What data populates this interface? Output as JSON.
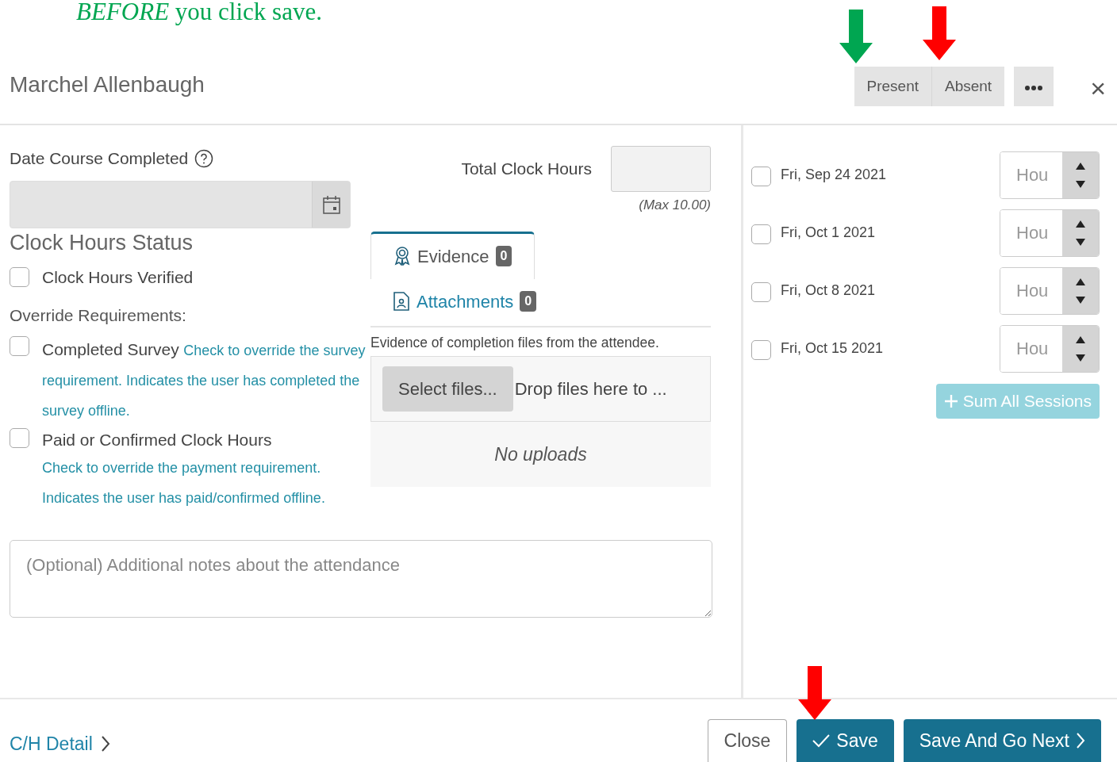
{
  "annotation": {
    "text": "*BEFORE* you click save."
  },
  "annotation_arrows": [
    {
      "color": "#00a651"
    },
    {
      "color": "#ff0000"
    },
    {
      "color": "#ff0000"
    }
  ],
  "header": {
    "title": "Marchel Allenbaugh",
    "attendance_buttons": [
      {
        "label": "Present",
        "selected": false
      },
      {
        "label": "Absent",
        "selected": false
      }
    ],
    "close": "×"
  },
  "date_course_completed": {
    "label": "Date Course Completed"
  },
  "total_clock_hours": {
    "label": "Total Clock Hours",
    "hint": "(Max 10.00)"
  },
  "clock_hours_status": {
    "heading": "Clock Hours Status",
    "verified": {
      "label": "Clock Hours Verified",
      "checked": false
    }
  },
  "override_requirements": {
    "heading": "Override Requirements:",
    "items": [
      {
        "label": "Completed Survey",
        "description": "Check to override the survey requirement. Indicates the user has completed the survey offline.",
        "checked": false
      },
      {
        "label": "Paid or Confirmed Clock Hours",
        "description": "Check to override the payment requirement. Indicates the user has paid/confirmed offline.",
        "checked": false
      }
    ]
  },
  "tabs": [
    {
      "label": "Evidence",
      "count": "0",
      "selected": true,
      "kind": "award"
    },
    {
      "label": "Attachments",
      "count": "0",
      "selected": false,
      "kind": "document"
    }
  ],
  "tab_description": "Evidence of completion files from the attendee.",
  "upload": {
    "select_button": "Select files...",
    "drop_text": "Drop files here to ...",
    "empty": "No uploads"
  },
  "notes": {
    "placeholder": "(Optional) Additional notes about the attendance"
  },
  "sessions": [
    {
      "date": "Fri, Sep 24 2021",
      "checked": false,
      "placeholder": "Hou"
    },
    {
      "date": "Fri, Oct 1 2021",
      "checked": false,
      "placeholder": "Hou"
    },
    {
      "date": "Fri, Oct 8 2021",
      "checked": false,
      "placeholder": "Hou"
    },
    {
      "date": "Fri, Oct 15 2021",
      "checked": false,
      "placeholder": "Hou"
    }
  ],
  "sum_button": {
    "label": "Sum All Sessions",
    "disabled": true
  },
  "footer": {
    "detail_link": "C/H Detail",
    "buttons": [
      {
        "label": "Close",
        "kind": "outline"
      },
      {
        "label": "Save",
        "kind": "check"
      },
      {
        "label": "Save And Go Next",
        "kind": "next"
      }
    ]
  }
}
